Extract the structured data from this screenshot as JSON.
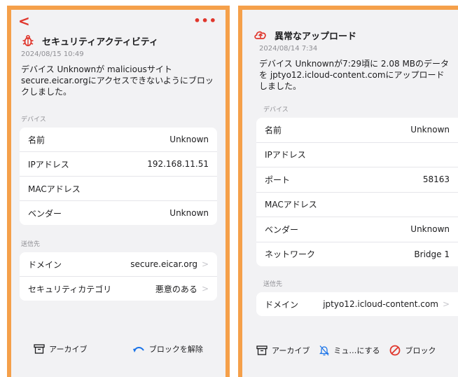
{
  "left": {
    "back_glyph": "<",
    "more_glyph": "•••",
    "title": "セキュリティアクティビティ",
    "date": "2024/08/15 10:49",
    "description": "デバイス Unknownが maliciousサイト secure.eicar.orgにアクセスできないようにブロックしました。",
    "device_section": "デバイス",
    "device_rows": [
      {
        "label": "名前",
        "value": "Unknown"
      },
      {
        "label": "IPアドレス",
        "value": "192.168.11.51"
      },
      {
        "label": "MACアドレス",
        "value": ""
      },
      {
        "label": "ベンダー",
        "value": "Unknown"
      }
    ],
    "dest_section": "送信先",
    "dest_rows": [
      {
        "label": "ドメイン",
        "value": "secure.eicar.org"
      },
      {
        "label": "セキュリティカテゴリ",
        "value": "悪意のある"
      }
    ],
    "archive_label": "アーカイブ",
    "unblock_label": "ブロックを解除"
  },
  "right": {
    "title": "異常なアップロード",
    "date": "2024/08/14 7:34",
    "description": "デバイス Unknownが7:29頃に 2.08 MBのデータを jptyo12.icloud-content.comにアップロードしました。",
    "device_section": "デバイス",
    "device_rows": [
      {
        "label": "名前",
        "value": "Unknown"
      },
      {
        "label": "IPアドレス",
        "value": ""
      },
      {
        "label": "ポート",
        "value": "58163"
      },
      {
        "label": "MACアドレス",
        "value": ""
      },
      {
        "label": "ベンダー",
        "value": "Unknown"
      },
      {
        "label": "ネットワーク",
        "value": "Bridge 1"
      }
    ],
    "dest_section": "送信先",
    "dest_rows": [
      {
        "label": "ドメイン",
        "value": "jptyo12.icloud-content.com"
      }
    ],
    "archive_label": "アーカイブ",
    "mute_label": "ミュ…にする",
    "block_label": "ブロック"
  },
  "colors": {
    "accent": "#e0362c",
    "frame": "#f5a04a",
    "link_blue": "#1a73e8"
  }
}
